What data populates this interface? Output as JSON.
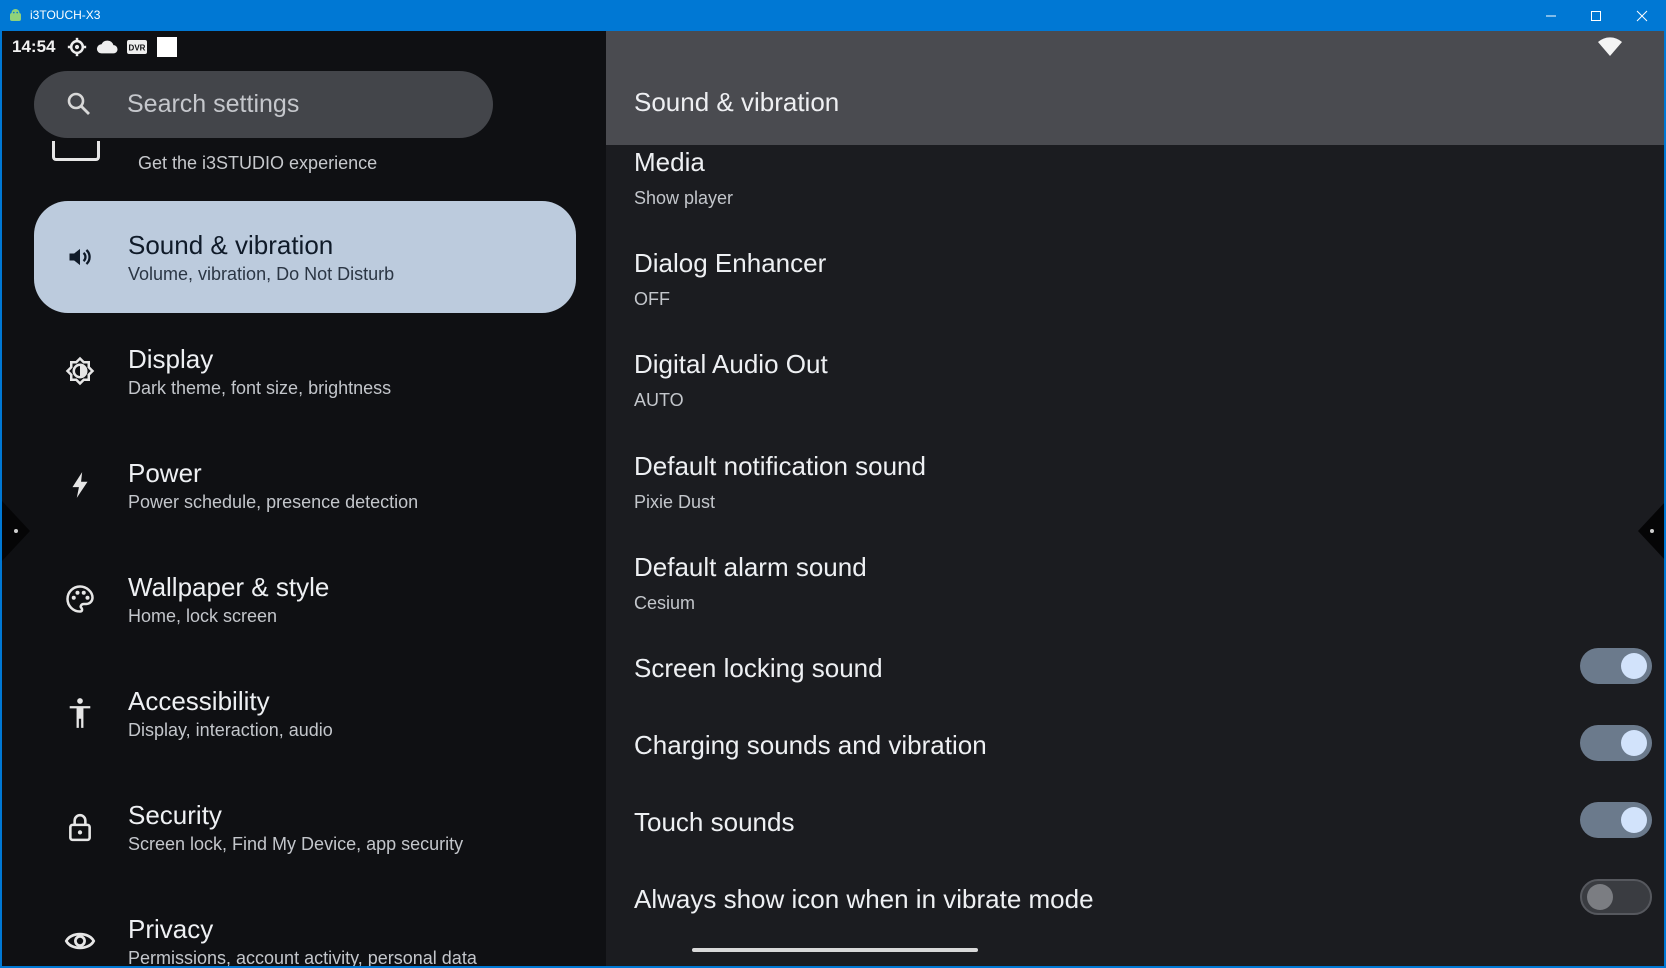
{
  "window": {
    "title": "i3TOUCH-X3"
  },
  "status_bar": {
    "time": "14:54",
    "icons": [
      "gear-icon",
      "cloud-icon",
      "dvr-icon",
      "square-icon",
      "wifi-icon"
    ]
  },
  "search": {
    "placeholder": "Search settings"
  },
  "sidebar": {
    "partial_item": {
      "subtitle": "Get the i3STUDIO experience"
    },
    "items": [
      {
        "title": "Sound & vibration",
        "subtitle": "Volume, vibration, Do Not Disturb",
        "icon": "speaker-icon",
        "active": true
      },
      {
        "title": "Display",
        "subtitle": "Dark theme, font size, brightness",
        "icon": "brightness-icon"
      },
      {
        "title": "Power",
        "subtitle": "Power schedule, presence detection",
        "icon": "bolt-icon"
      },
      {
        "title": "Wallpaper & style",
        "subtitle": "Home, lock screen",
        "icon": "palette-icon"
      },
      {
        "title": "Accessibility",
        "subtitle": "Display, interaction, audio",
        "icon": "accessibility-icon"
      },
      {
        "title": "Security",
        "subtitle": "Screen lock, Find My Device, app security",
        "icon": "lock-icon"
      },
      {
        "title": "Privacy",
        "subtitle": "Permissions, account activity, personal data",
        "icon": "eye-icon"
      }
    ]
  },
  "detail": {
    "title": "Sound & vibration",
    "prefs": [
      {
        "title": "Media",
        "subtitle": "Show player"
      },
      {
        "title": "Dialog Enhancer",
        "subtitle": "OFF"
      },
      {
        "title": "Digital Audio Out",
        "subtitle": "AUTO"
      },
      {
        "title": "Default notification sound",
        "subtitle": "Pixie Dust"
      },
      {
        "title": "Default alarm sound",
        "subtitle": "Cesium"
      }
    ],
    "toggles": [
      {
        "title": "Screen locking sound",
        "on": true
      },
      {
        "title": "Charging sounds and vibration",
        "on": true
      },
      {
        "title": "Touch sounds",
        "on": true
      },
      {
        "title": "Always show icon when in vibrate mode",
        "on": false
      }
    ]
  },
  "colors": {
    "titlebar": "#0078d4",
    "active_item": "#bccbdd",
    "toggle_knob_on": "#d2e3fb",
    "toggle_track_on": "#6b7a8c"
  }
}
